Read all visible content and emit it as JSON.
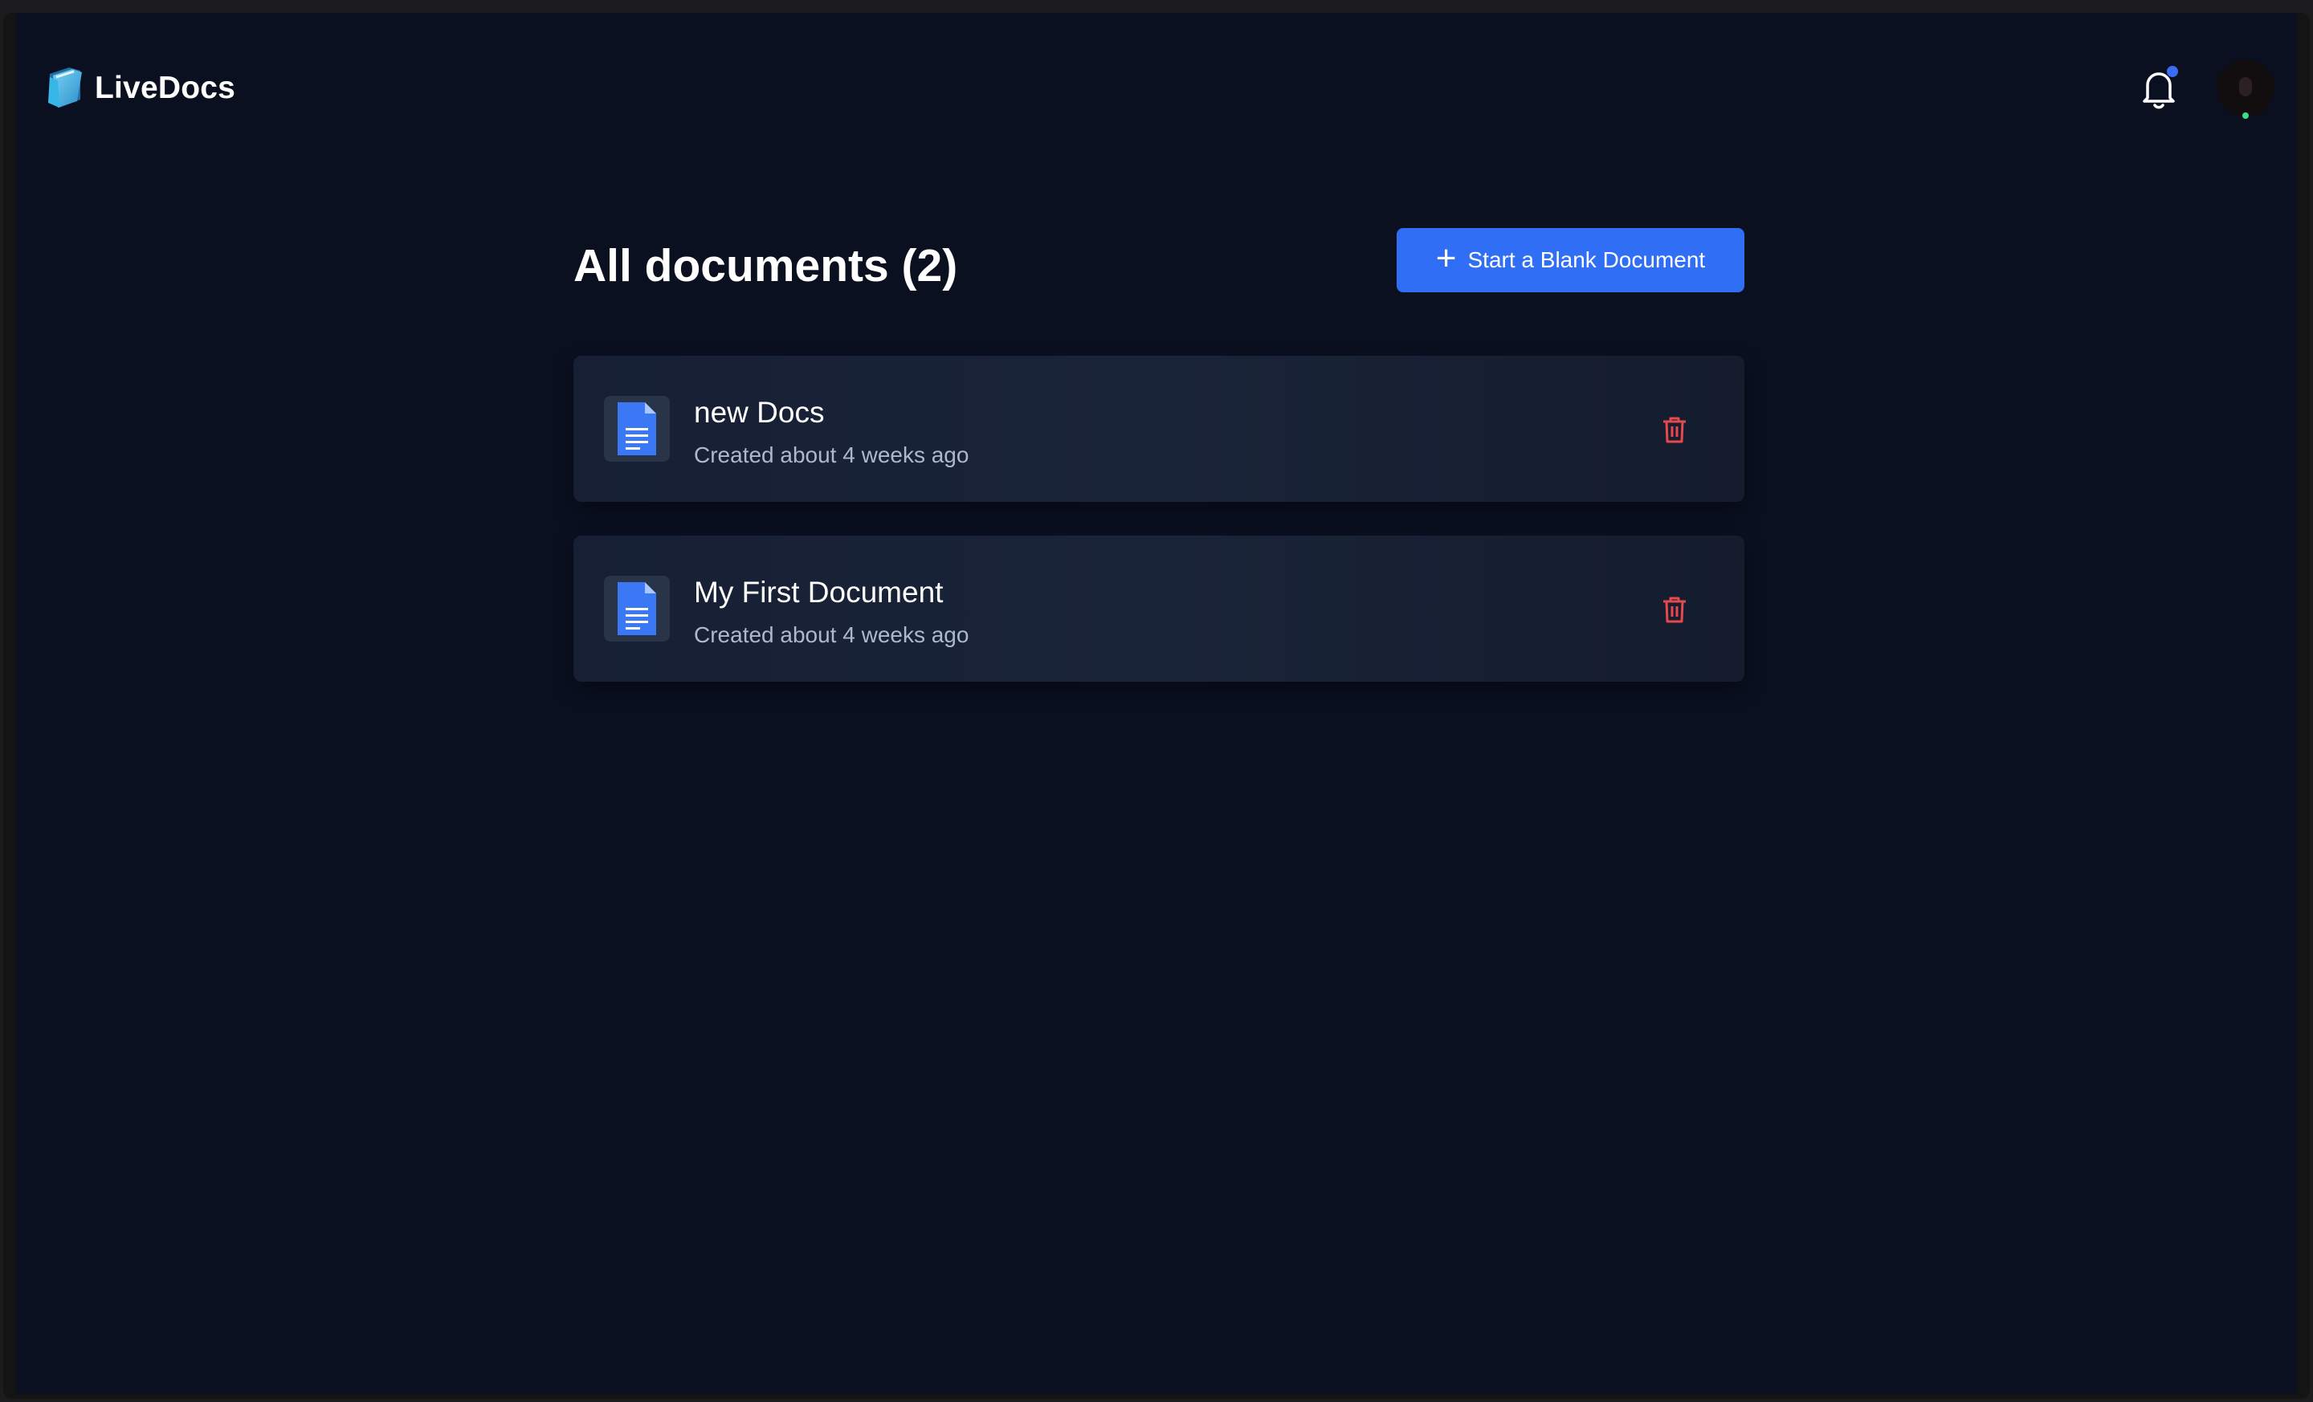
{
  "header": {
    "app_name": "LiveDocs",
    "logo_icon": "folder-logo-icon",
    "notification_icon": "bell-icon",
    "has_unread_notifications": true,
    "avatar_online": true
  },
  "main": {
    "title": "All documents (2)",
    "new_button_label": "Start a Blank Document",
    "new_button_icon": "plus-icon",
    "documents": [
      {
        "name": "new Docs",
        "created": "Created about 4 weeks ago",
        "icon": "document-icon",
        "action_icon": "trash-icon"
      },
      {
        "name": "My First Document",
        "created": "Created about 4 weeks ago",
        "icon": "document-icon",
        "action_icon": "trash-icon"
      }
    ]
  },
  "colors": {
    "background": "#0a1020",
    "accent": "#2f6ef5",
    "delete": "#e5484d",
    "card": "#1a2438"
  }
}
